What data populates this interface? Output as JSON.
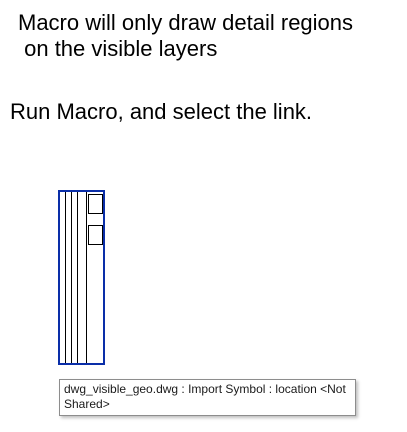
{
  "instructions": {
    "line1": "Macro will only draw detail regions\n on the visible layers",
    "line2": "Run Macro, and select the link."
  },
  "tooltip": {
    "text": "dwg_visible_geo.dwg : Import Symbol : location <Not Shared>"
  },
  "colors": {
    "selection_highlight": "#0a2ea8"
  }
}
